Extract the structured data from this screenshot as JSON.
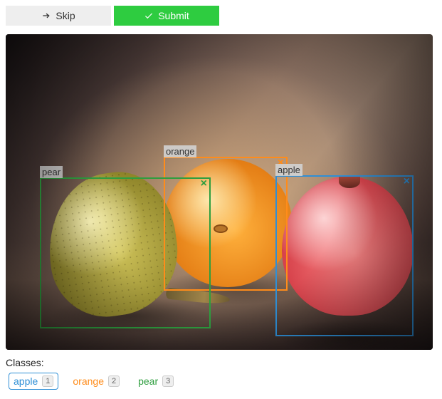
{
  "toolbar": {
    "skip_label": "Skip",
    "submit_label": "Submit"
  },
  "boxes": {
    "pear": {
      "label": "pear",
      "close": "×"
    },
    "orange": {
      "label": "orange",
      "close": "×"
    },
    "apple": {
      "label": "apple",
      "close": "×"
    }
  },
  "classes": {
    "heading": "Classes:",
    "items": [
      {
        "name": "apple",
        "key": "1",
        "color": "#2f8fd6",
        "active": true
      },
      {
        "name": "orange",
        "key": "2",
        "color": "#ff8c1a",
        "active": false
      },
      {
        "name": "pear",
        "key": "3",
        "color": "#2e9e3f",
        "active": false
      }
    ]
  }
}
